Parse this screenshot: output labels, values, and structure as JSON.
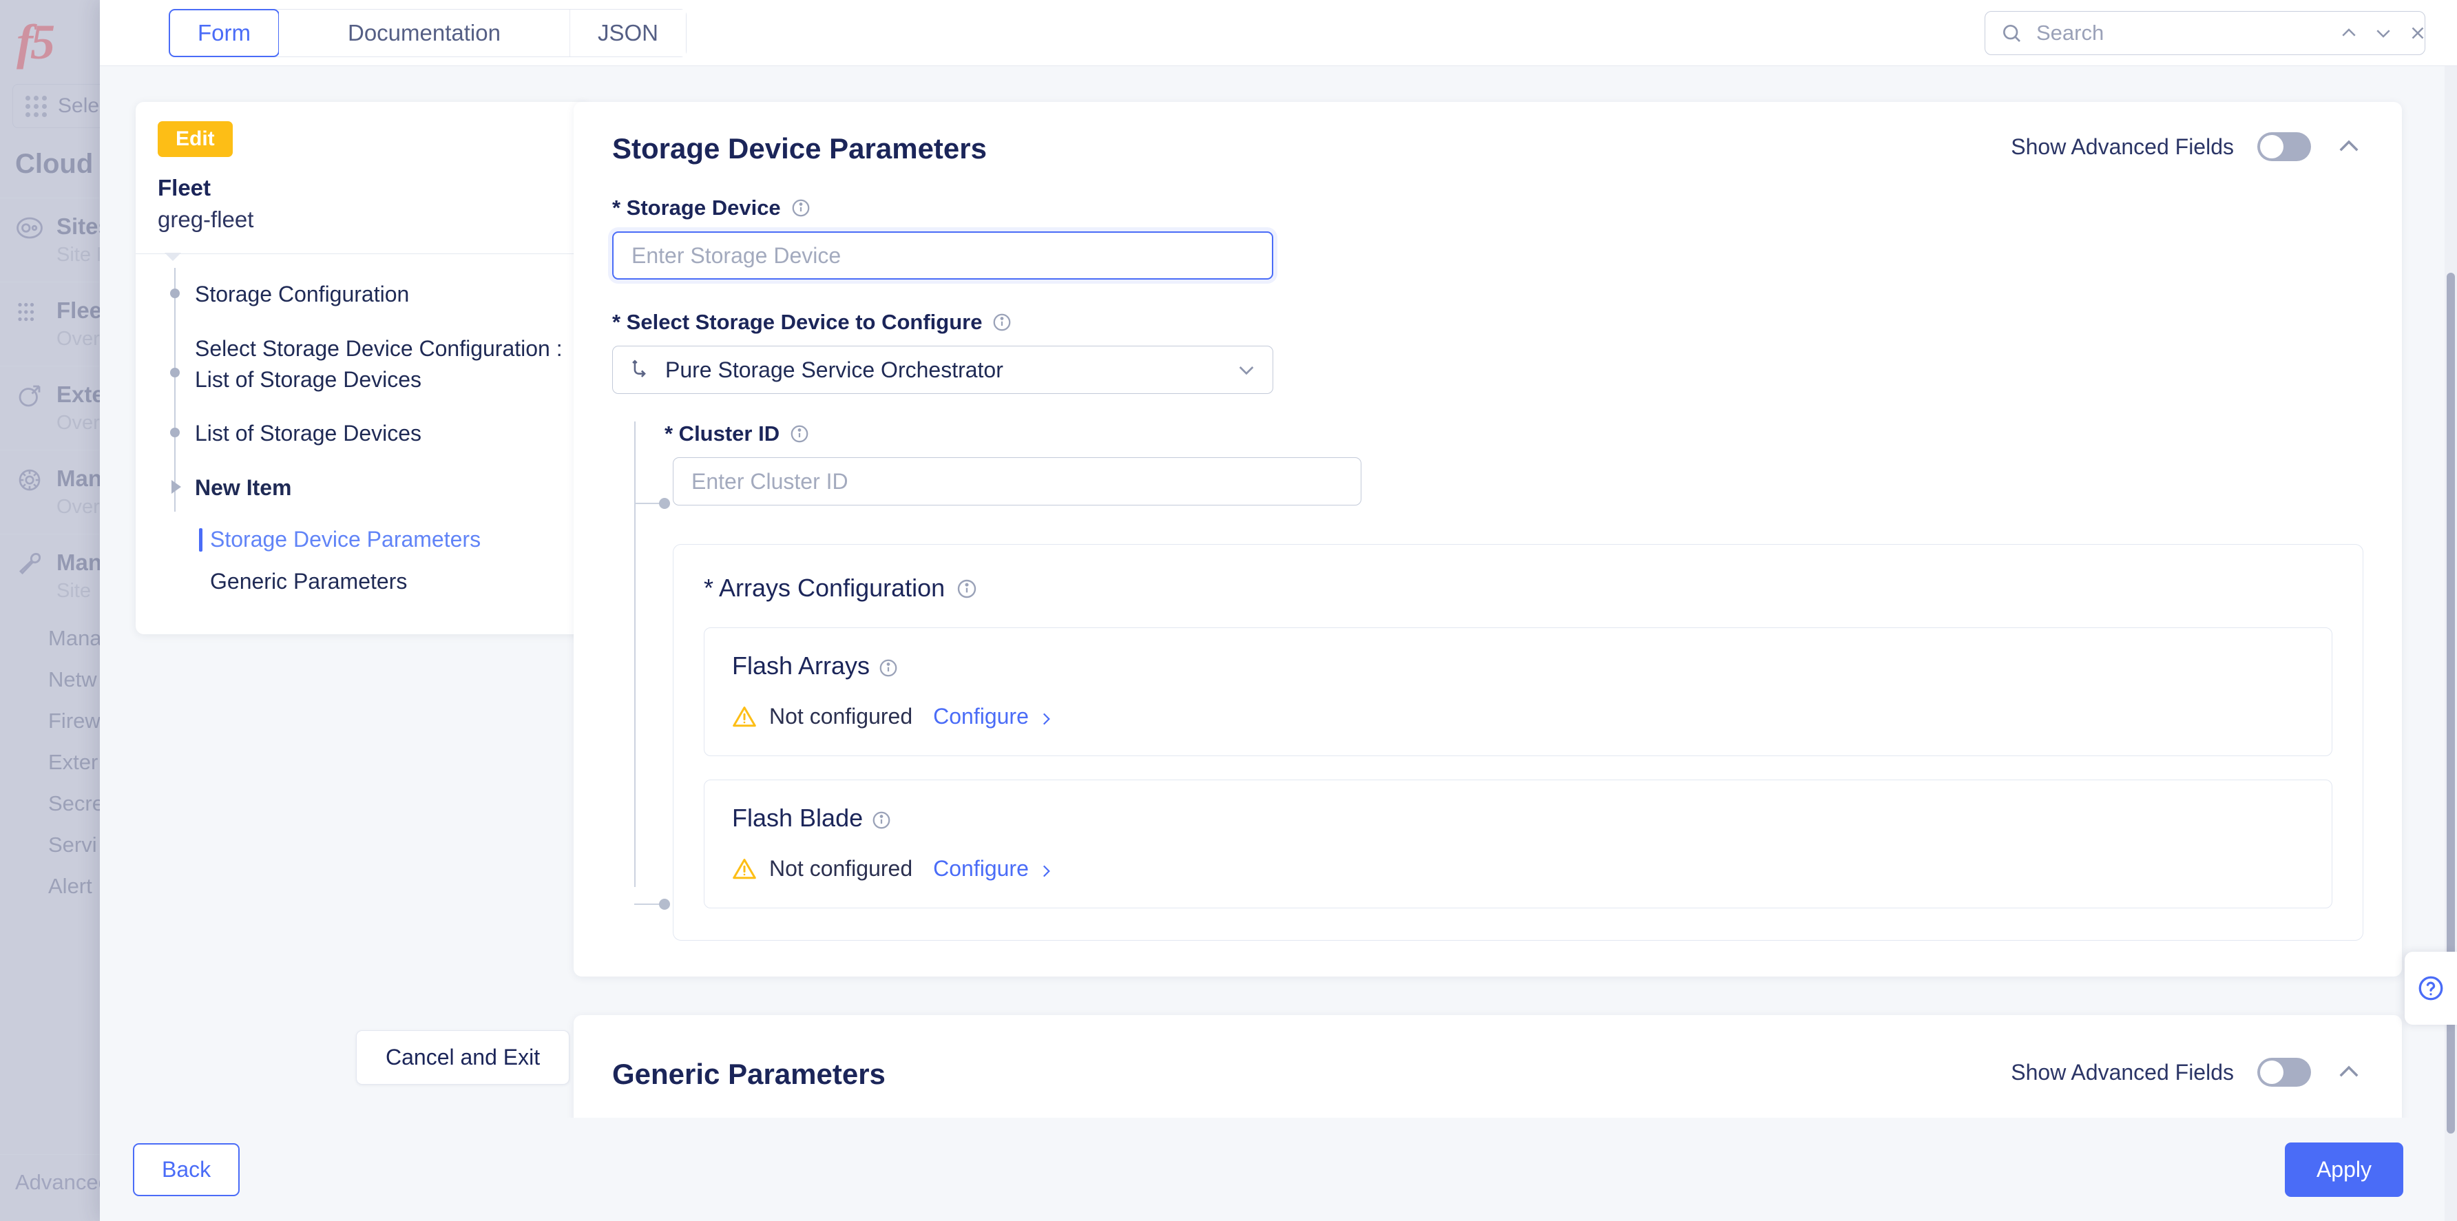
{
  "background_app": {
    "logo": "f5-logo",
    "tenant_selector": "Sele",
    "section_title": "Cloud a",
    "nav": [
      {
        "label": "Sites",
        "sub": "Site M",
        "icon": "globe-icon"
      },
      {
        "label": "Flee",
        "sub": "Overv",
        "icon": "fleet-icon"
      },
      {
        "label": "Exte",
        "sub": "Overv",
        "icon": "external-icon"
      },
      {
        "label": "Man",
        "sub": "Overv",
        "icon": "kubernetes-icon"
      },
      {
        "label": "Man",
        "sub": "Site ",
        "icon": "wrench-icon"
      }
    ],
    "sub_items": [
      "Mana",
      "Netw",
      "Firew",
      "Exter",
      "Secre",
      "Servi",
      "Alert"
    ],
    "advanced": "Advanced"
  },
  "topbar": {
    "tabs": [
      {
        "label": "Form",
        "active": true
      },
      {
        "label": "Documentation",
        "active": false
      },
      {
        "label": "JSON",
        "active": false
      }
    ],
    "search": {
      "placeholder": "Search",
      "value": "",
      "icon": "search-icon",
      "prev": "chevron-up-icon",
      "next": "chevron-down-icon",
      "close": "close-icon"
    }
  },
  "wizard": {
    "edit_badge": "Edit",
    "object_type": "Fleet",
    "object_name": "greg-fleet",
    "steps": [
      {
        "label": "Storage Configuration",
        "current": false
      },
      {
        "label": "Select Storage Device Configuration : List of Storage Devices",
        "current": false
      },
      {
        "label": "List of Storage Devices",
        "current": false
      },
      {
        "label": "New Item",
        "current": true
      }
    ],
    "substeps": [
      {
        "label": "Storage Device Parameters",
        "active": true
      },
      {
        "label": "Generic Parameters",
        "active": false
      }
    ],
    "cancel_exit": "Cancel and Exit"
  },
  "storage_device_parameters": {
    "title": "Storage Device Parameters",
    "advanced_label": "Show Advanced Fields",
    "advanced_on": false,
    "collapse_icon": "chevron-up-icon",
    "storage_device": {
      "label": "* Storage Device",
      "placeholder": "Enter Storage Device",
      "value": "",
      "info_icon": "info-icon",
      "focused": true
    },
    "select_device": {
      "label": "* Select Storage Device to Configure",
      "value": "Pure Storage Service Orchestrator",
      "info_icon": "info-icon",
      "leading_icon": "branch-icon",
      "chevron": "chevron-down-icon"
    },
    "cluster_id": {
      "label": "* Cluster ID",
      "placeholder": "Enter Cluster ID",
      "value": "",
      "info_icon": "info-icon"
    },
    "arrays_configuration": {
      "label": "* Arrays Configuration",
      "info_icon": "info-icon",
      "items": [
        {
          "title": "Flash Arrays",
          "info_icon": "info-icon",
          "status_icon": "warning-icon",
          "status": "Not configured",
          "action": "Configure",
          "action_icon": "chevron-right-icon"
        },
        {
          "title": "Flash Blade",
          "info_icon": "info-icon",
          "status_icon": "warning-icon",
          "status": "Not configured",
          "action": "Configure",
          "action_icon": "chevron-right-icon"
        }
      ]
    }
  },
  "generic_parameters": {
    "title": "Generic Parameters",
    "advanced_label": "Show Advanced Fields",
    "advanced_on": false,
    "collapse_icon": "chevron-up-icon"
  },
  "footer": {
    "back": "Back",
    "apply": "Apply"
  },
  "help": {
    "icon": "question-circle-icon"
  },
  "colors": {
    "accent": "#4a6cf7",
    "badge": "#fdbe16",
    "warning": "#fdbe16",
    "text_dark": "#1b2559"
  }
}
